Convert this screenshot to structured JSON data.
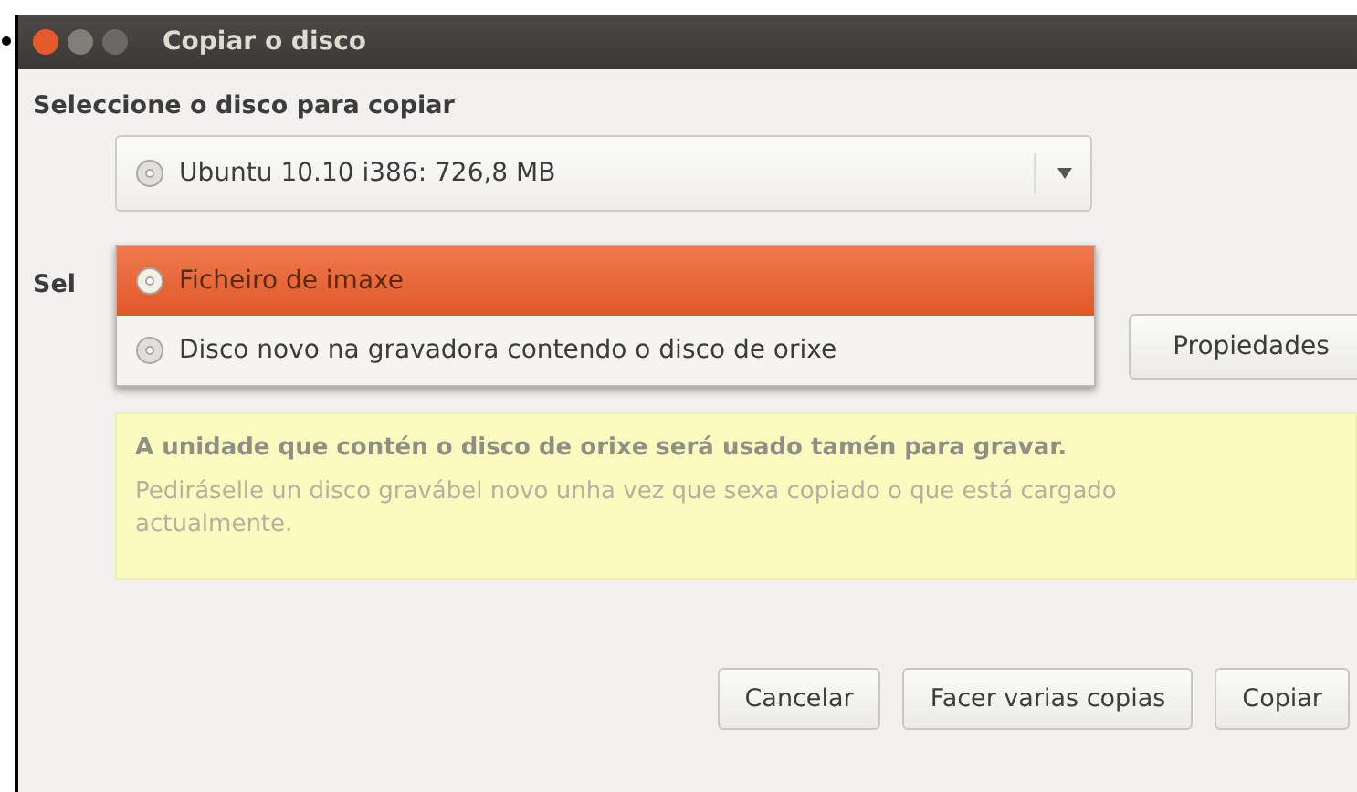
{
  "window": {
    "title": "Copiar o disco"
  },
  "source": {
    "label": "Seleccione o disco para copiar",
    "value": "Ubuntu 10.10 i386: 726,8 MB"
  },
  "destination": {
    "label": "Sel",
    "properties_button": "Propiedades",
    "menu": [
      {
        "label": "Ficheiro de imaxe",
        "selected": true
      },
      {
        "label": "Disco novo na gravadora contendo o disco de orixe",
        "selected": false
      }
    ]
  },
  "info": {
    "title": "A unidade que contén o disco de orixe será usado tamén para gravar.",
    "text": "Pediráselle un disco gravábel novo unha vez que sexa copiado o que está cargado actualmente."
  },
  "buttons": [
    "Cancelar",
    "Facer varias copias",
    "Copiar"
  ]
}
